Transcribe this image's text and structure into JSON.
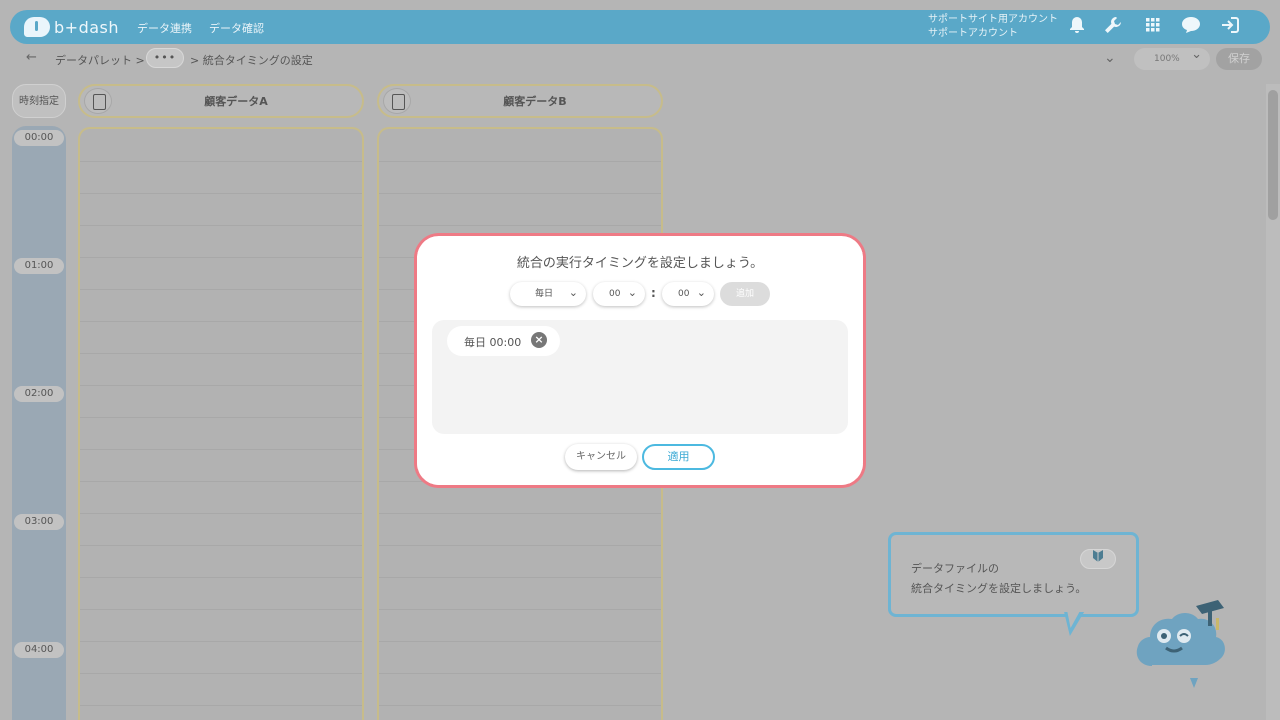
{
  "header": {
    "logo_text": "b+dash",
    "nav": [
      "データ連携",
      "データ確認"
    ],
    "account_line1": "サポートサイト用アカウント",
    "account_line2": "サポートアカウント"
  },
  "toolbar": {
    "crumb_root": "データパレット >",
    "crumb_more": "•••",
    "crumb_current": "> 統合タイミングの設定",
    "zoom": "100%",
    "save_label": "保存"
  },
  "timeline": {
    "head": "時刻指定",
    "times": [
      "00:00",
      "01:00",
      "02:00",
      "03:00",
      "04:00"
    ]
  },
  "columns": [
    {
      "title": "顧客データA"
    },
    {
      "title": "顧客データB"
    }
  ],
  "modal": {
    "title": "統合の実行タイミングを設定しましょう。",
    "frequency": "毎日",
    "hour": "00",
    "colon": ":",
    "minute": "00",
    "add_label": "追加",
    "schedule_chip": "毎日 00:00",
    "cancel_label": "キャンセル",
    "apply_label": "適用"
  },
  "tooltip": {
    "line1": "データファイルの",
    "line2": "統合タイミングを設定しましょう。",
    "badge": "🔰"
  },
  "colors": {
    "header": "#5aa8c8",
    "modal_border": "#ee7a85",
    "apply": "#4cb9e0"
  }
}
